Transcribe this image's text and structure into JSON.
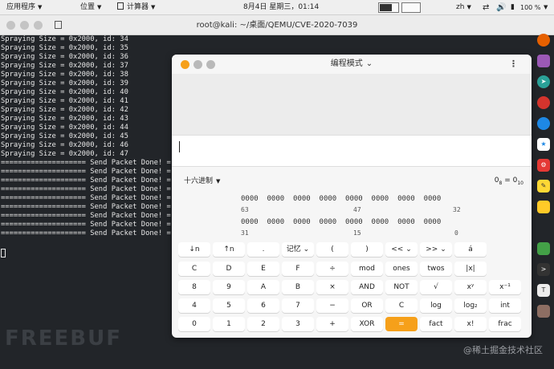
{
  "topbar": {
    "apps_label": "应用程序",
    "places_label": "位置",
    "calc_label": "计算器",
    "clock": "8月4日 星期三，01:14",
    "input_method": "zh",
    "battery": "100 %"
  },
  "terminal": {
    "title": "root@kali: ~/桌面/QEMU/CVE-2020-7039",
    "lines": [
      "Spraying Size = 0x2000, id: 34",
      "Spraying Size = 0x2000, id: 35",
      "Spraying Size = 0x2000, id: 36",
      "Spraying Size = 0x2000, id: 37",
      "Spraying Size = 0x2000, id: 38",
      "Spraying Size = 0x2000, id: 39",
      "Spraying Size = 0x2000, id: 40",
      "Spraying Size = 0x2000, id: 41",
      "Spraying Size = 0x2000, id: 42",
      "Spraying Size = 0x2000, id: 43",
      "Spraying Size = 0x2000, id: 44",
      "Spraying Size = 0x2000, id: 45",
      "Spraying Size = 0x2000, id: 46",
      "Spraying Size = 0x2000, id: 47",
      "==================== Send Packet Done! =",
      "==================== Send Packet Done! =",
      "==================== Send Packet Done! =",
      "==================== Send Packet Done! =",
      "==================== Send Packet Done! =",
      "==================== Send Packet Done! =",
      "==================== Send Packet Done! =",
      "==================== Send Packet Done! =",
      "==================== Send Packet Done! ="
    ]
  },
  "watermark": "FREEBUF",
  "site_mark": "@稀土掘金技术社区",
  "calculator": {
    "title": "编程模式",
    "display_value": "",
    "base_label": "十六进制",
    "conversion": {
      "main": "0",
      "from_sub": "8",
      "equals": " = ",
      "to_main": "0",
      "to_sub": "10"
    },
    "bits_row1": "0000  0000  0000  0000  0000  0000  0000  0000",
    "bits_row2": "0000  0000  0000  0000  0000  0000  0000  0000",
    "bitpos_row1": [
      "63",
      "47",
      "32"
    ],
    "bitpos_row2": [
      "31",
      "15",
      "0"
    ],
    "keys": [
      [
        "↓n",
        "↑n",
        ".",
        "记忆 ⌄",
        "(",
        ")",
        "<< ⌄",
        ">> ⌄",
        "á"
      ],
      [
        "C",
        "D",
        "E",
        "F",
        "÷",
        "mod",
        "ones",
        "twos",
        "|x|"
      ],
      [
        "8",
        "9",
        "A",
        "B",
        "×",
        "AND",
        "NOT",
        "√",
        "xʸ",
        "x⁻¹"
      ],
      [
        "4",
        "5",
        "6",
        "7",
        "−",
        "OR",
        "C",
        "log",
        "log₂",
        "int"
      ],
      [
        "0",
        "1",
        "2",
        "3",
        "+",
        "XOR",
        "=",
        "fact",
        "x!",
        "frac"
      ]
    ]
  },
  "dock_icons": [
    "firefox-icon",
    "screenshot-icon",
    "send-icon",
    "weibo-icon",
    "chat-icon",
    "app-icon",
    "gear-icon",
    "pen-icon",
    "folder-icon",
    "grid-icon",
    "terminal-icon",
    "text-icon",
    "box-icon"
  ]
}
